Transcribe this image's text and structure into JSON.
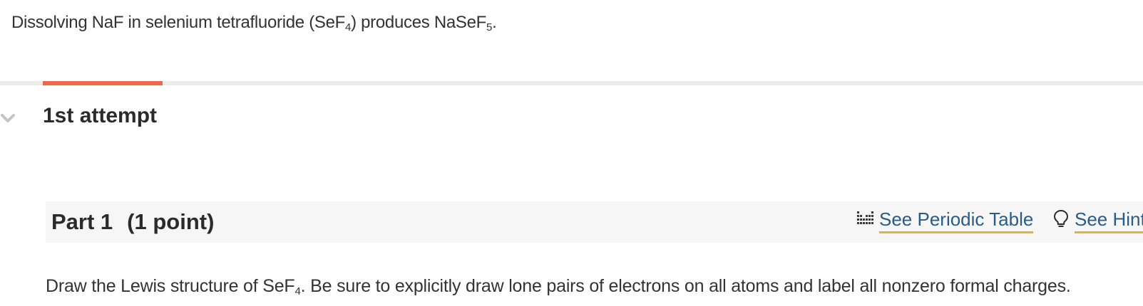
{
  "intro": {
    "part1": "Dissolving NaF in selenium tetrafluoride (SeF",
    "sub1": "4",
    "part2": ") produces NaSeF",
    "sub2": "5",
    "part3": "."
  },
  "progress": {
    "fraction": 0.105,
    "color": "#f0684a"
  },
  "attempt": {
    "title": "1st attempt",
    "chevron_icon": "chevron-down-icon"
  },
  "part": {
    "title": "Part 1",
    "points": "(1 point)",
    "periodic_table_label": "See Periodic Table",
    "periodic_table_icon": "periodic-table-icon",
    "hint_label": "See Hint",
    "hint_icon": "lightbulb-icon"
  },
  "instruction": {
    "part1": "Draw the Lewis structure of SeF",
    "sub": "4",
    "part2": ". Be sure to explicitly draw lone pairs of electrons on all atoms and label all nonzero formal charges."
  },
  "colors": {
    "accent": "#f0684a",
    "link": "#2a5c87",
    "link_underline": "#e2b23a"
  }
}
